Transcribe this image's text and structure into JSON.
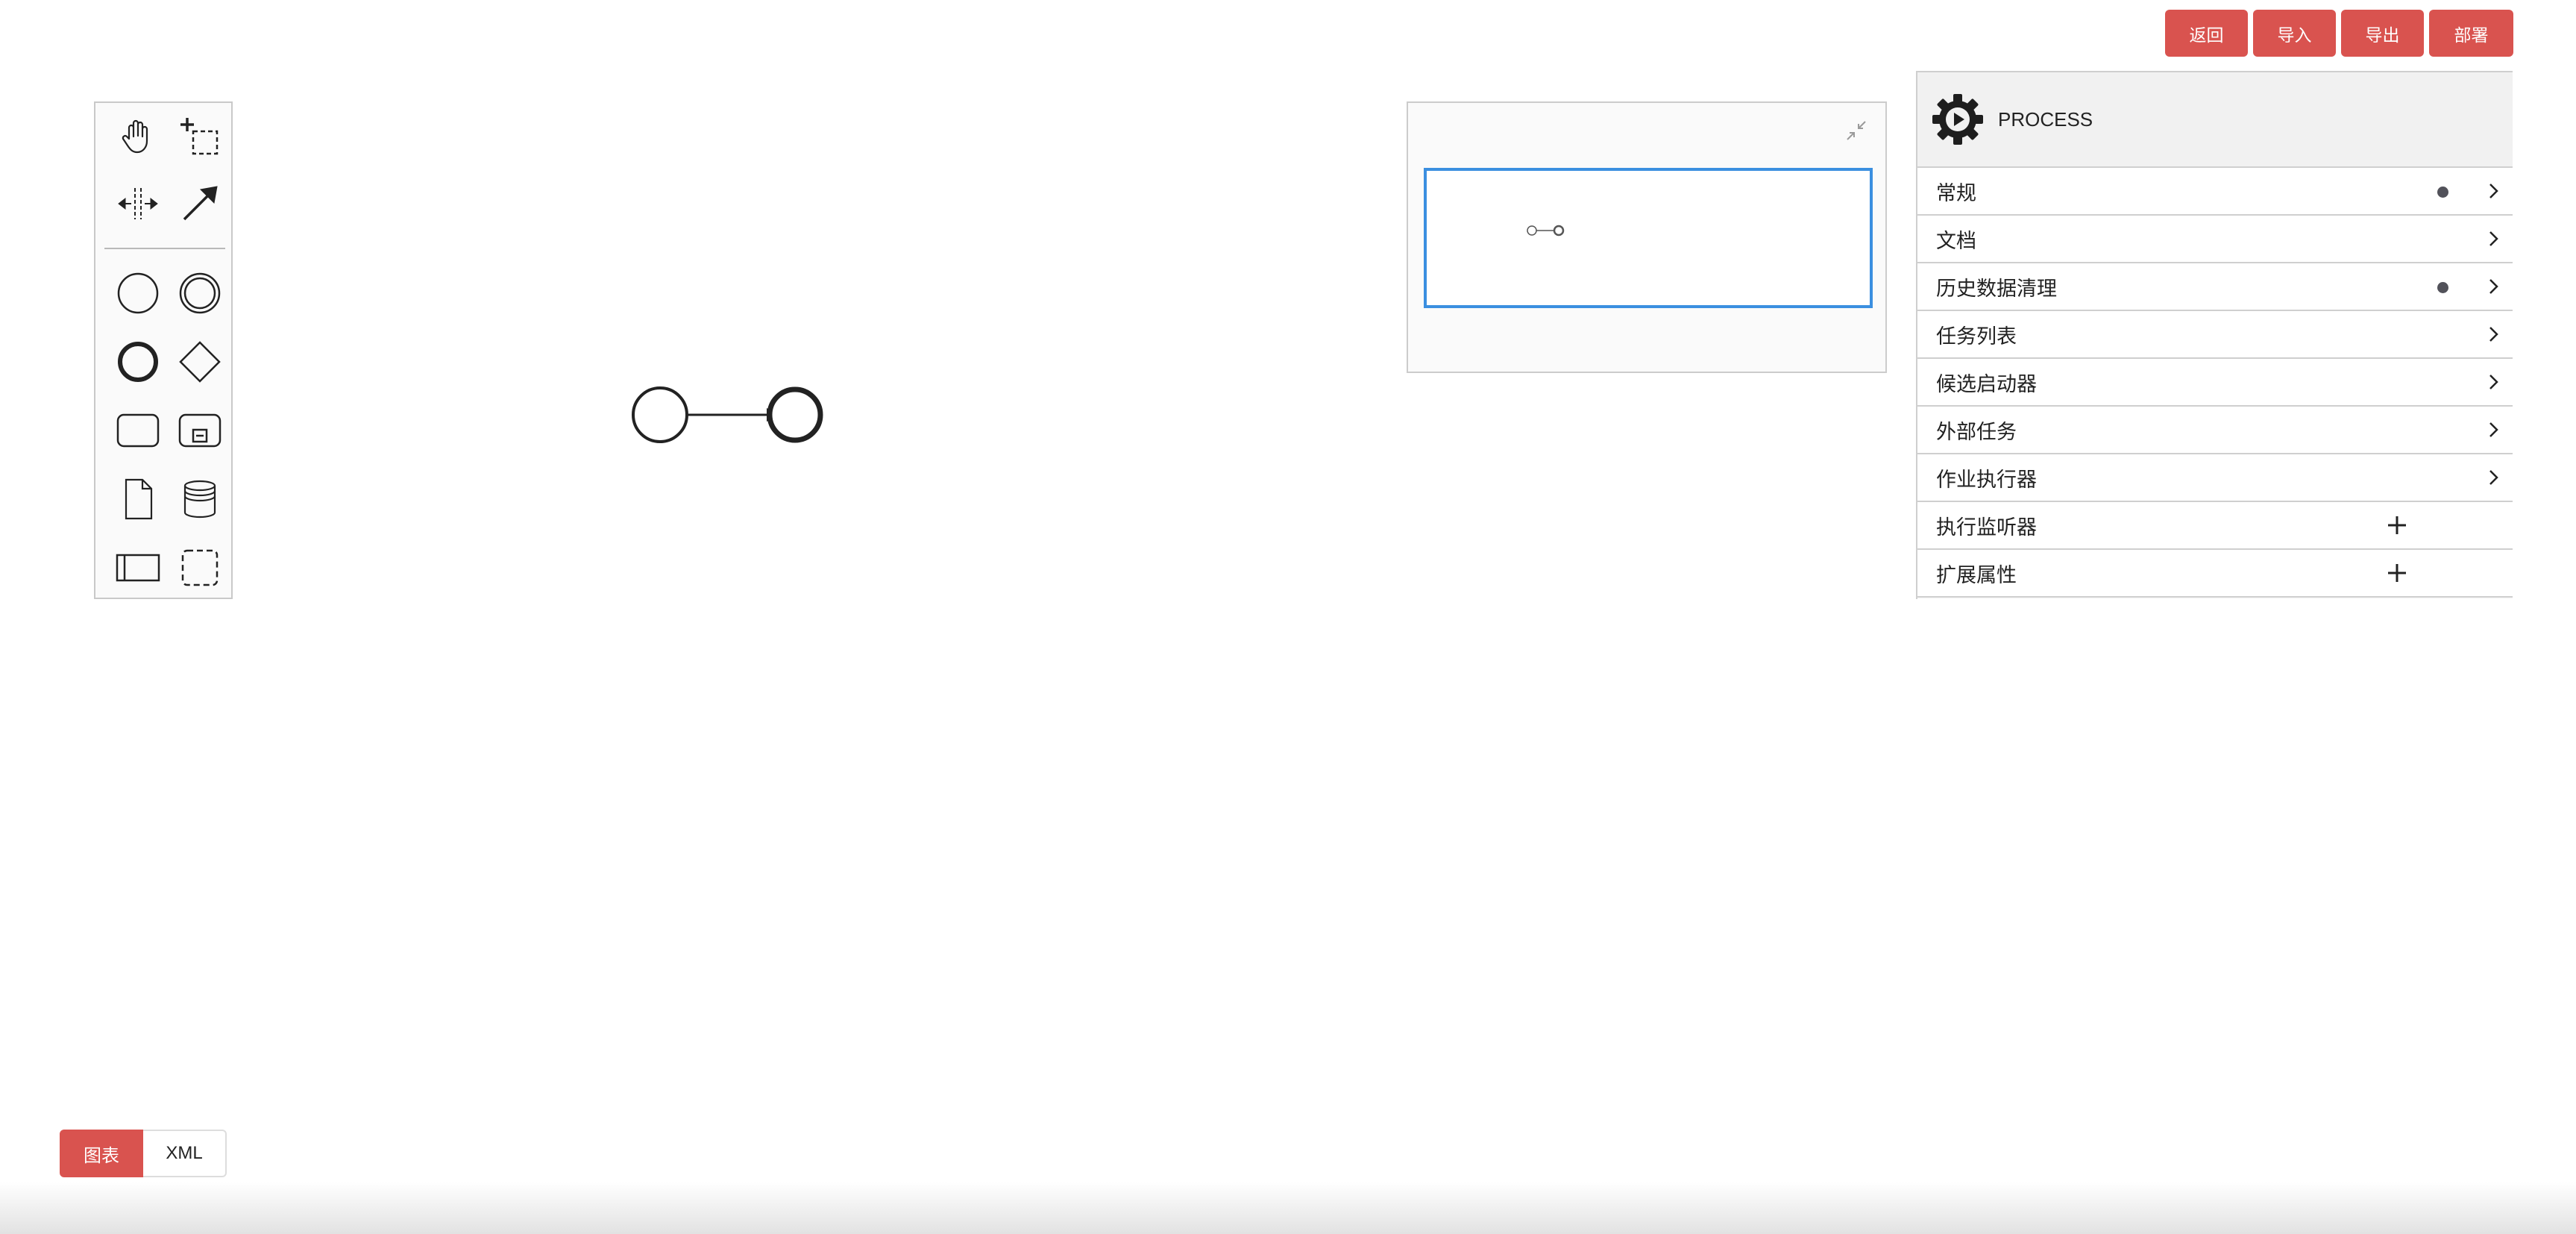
{
  "top_buttons": {
    "back": "返回",
    "import": "导入",
    "export": "导出",
    "deploy": "部署"
  },
  "palette": {
    "tools": [
      "hand-tool-icon",
      "lasso-tool-icon",
      "space-tool-icon",
      "global-connect-tool-icon",
      "start-event-icon",
      "intermediate-event-icon",
      "end-event-icon",
      "gateway-icon",
      "task-icon",
      "subprocess-icon",
      "data-object-icon",
      "data-store-icon",
      "participant-pool-icon",
      "group-icon"
    ]
  },
  "properties": {
    "element_type": "PROCESS",
    "groups": [
      {
        "label": "常规",
        "indicator": "dot",
        "action": "chevron"
      },
      {
        "label": "文档",
        "indicator": "",
        "action": "chevron"
      },
      {
        "label": "历史数据清理",
        "indicator": "dot",
        "action": "chevron"
      },
      {
        "label": "任务列表",
        "indicator": "",
        "action": "chevron"
      },
      {
        "label": "候选启动器",
        "indicator": "",
        "action": "chevron"
      },
      {
        "label": "外部任务",
        "indicator": "",
        "action": "chevron"
      },
      {
        "label": "作业执行器",
        "indicator": "",
        "action": "chevron"
      },
      {
        "label": "执行监听器",
        "indicator": "",
        "action": "plus"
      },
      {
        "label": "扩展属性",
        "indicator": "",
        "action": "plus"
      }
    ]
  },
  "view_tabs": {
    "diagram": "图表",
    "xml": "XML",
    "active": "diagram"
  },
  "colors": {
    "accent": "#d9534f",
    "minimap_viewport": "#3b8fe0",
    "indicator_dot": "#52525a"
  }
}
